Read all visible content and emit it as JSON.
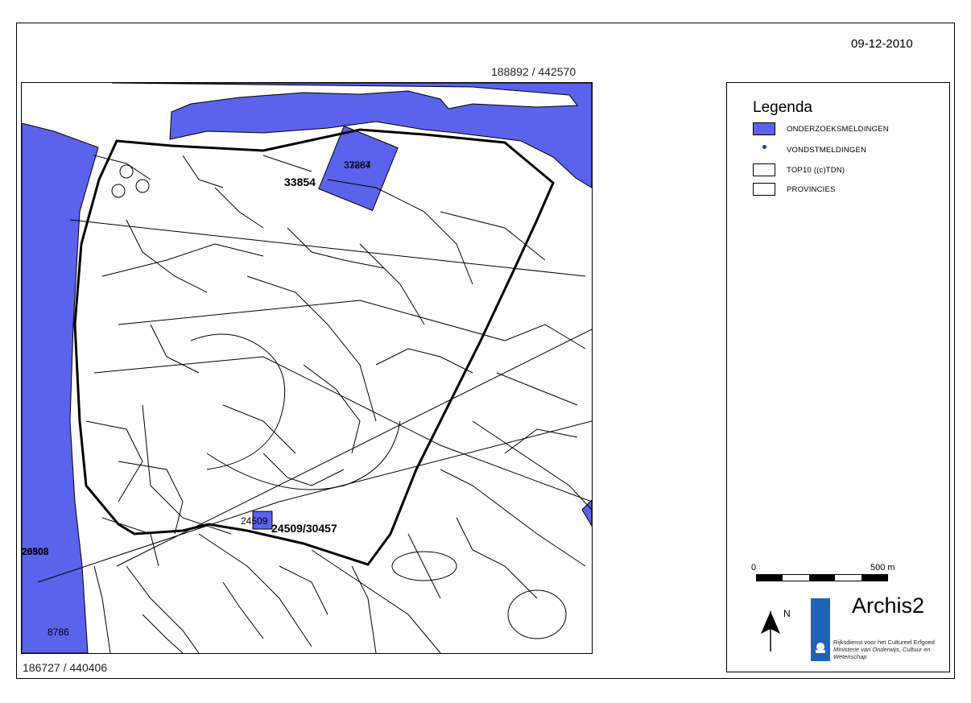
{
  "date": "09-12-2010",
  "coords": {
    "top_right": "188892 / 442570",
    "bottom_left": "186727 / 440406"
  },
  "colors": {
    "onderzoek": "#5b62ec",
    "vondst": "#1f3fa0",
    "brand": "#1e64b4"
  },
  "map": {
    "labels": {
      "a": "33854",
      "b": "33884",
      "c": "37267",
      "d": "24509/30457",
      "e": "24509",
      "f": "20508",
      "g": "26303",
      "h": "8786"
    }
  },
  "legend": {
    "title": "Legenda",
    "items": [
      {
        "label": "ONDERZOEKSMELDINGEN",
        "kind": "fill"
      },
      {
        "label": "VONDSTMELDINGEN",
        "kind": "dot"
      },
      {
        "label": "TOP10 ((c)TDN)",
        "kind": "box"
      },
      {
        "label": "PROVINCIES",
        "kind": "box"
      }
    ],
    "scale": {
      "min": "0",
      "max": "500 m"
    },
    "north": "N",
    "app": "Archis2",
    "institution": {
      "line1": "Rijksdienst voor het Cultureel Erfgoed",
      "line2": "Ministerie van Onderwijs, Cultuur en",
      "line3": "Wetenschap"
    }
  }
}
